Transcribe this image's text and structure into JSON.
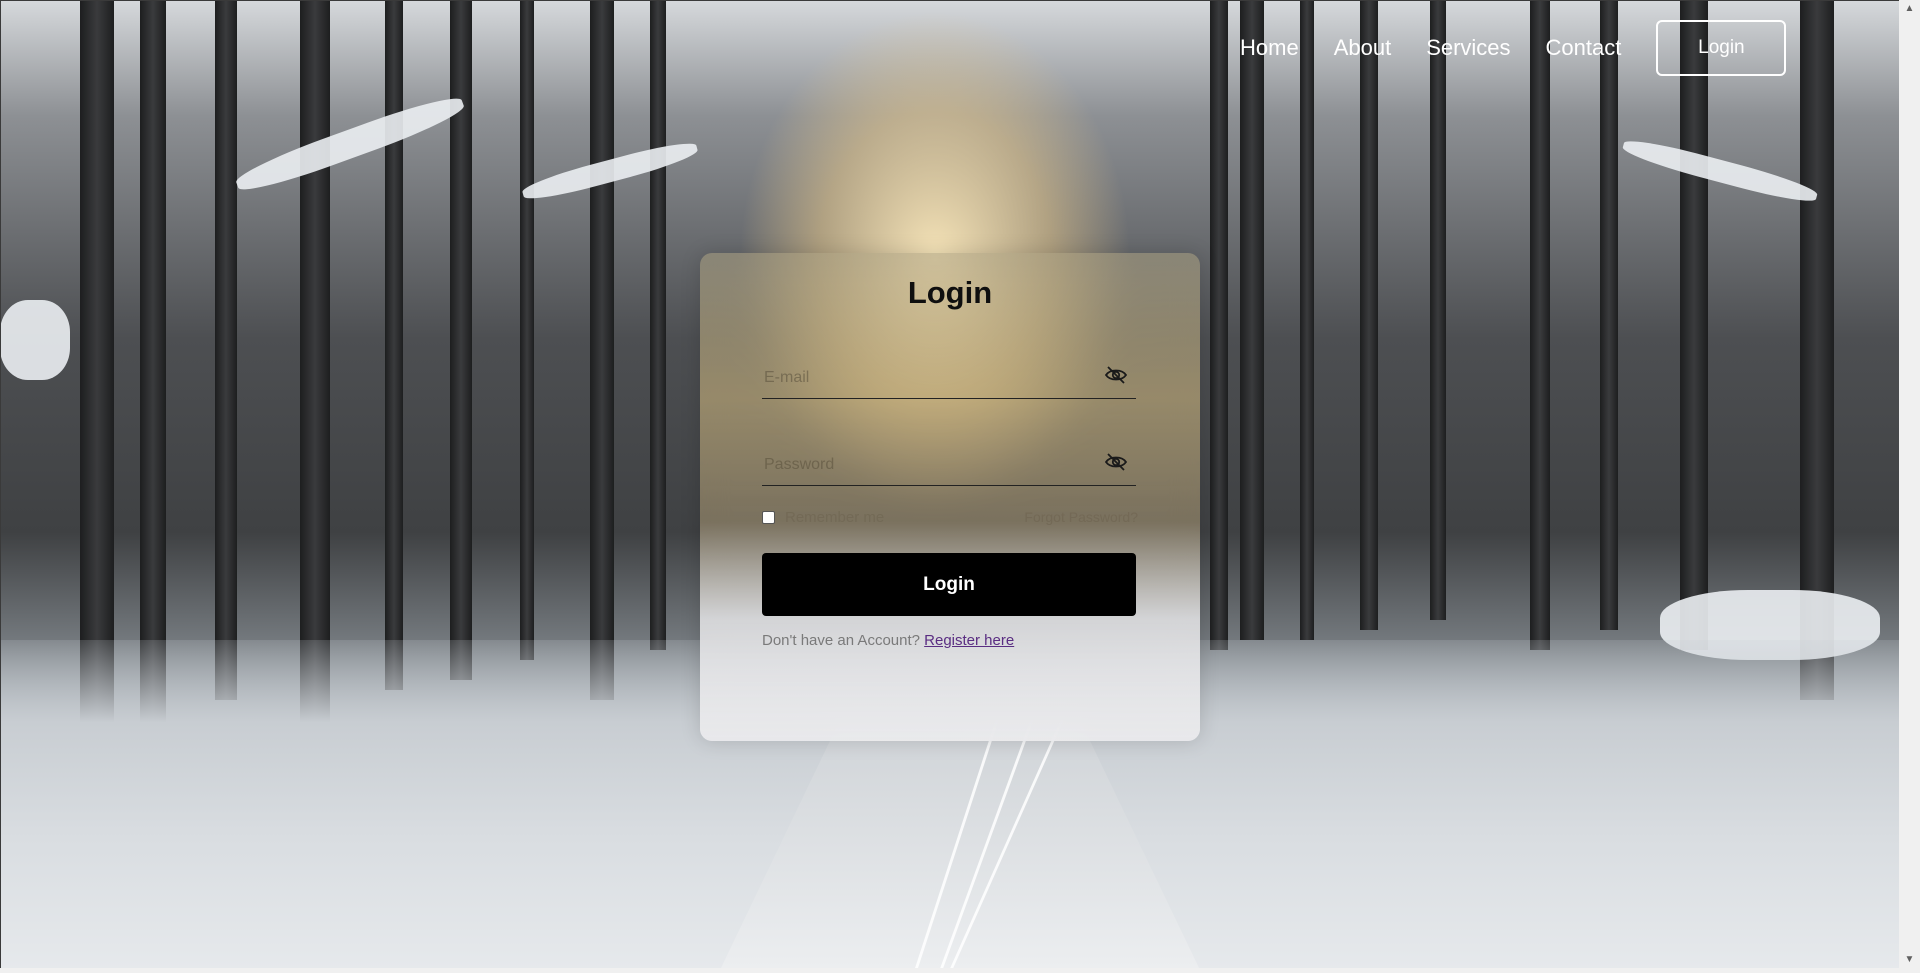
{
  "nav": {
    "links": [
      "Home",
      "About",
      "Services",
      "Contact"
    ],
    "login_button": "Login"
  },
  "card": {
    "title": "Login",
    "email_placeholder": "E-mail",
    "password_placeholder": "Password",
    "remember_label": "Remember me",
    "forgot_label": "Forgot Password?",
    "submit_label": "Login",
    "register_prompt": "Don't have an Account?",
    "register_link": "Register here"
  },
  "icons": {
    "email_toggle": "eye-off-icon",
    "password_toggle": "eye-off-icon"
  },
  "colors": {
    "button_bg": "#000000",
    "link": "#5a2d82"
  }
}
